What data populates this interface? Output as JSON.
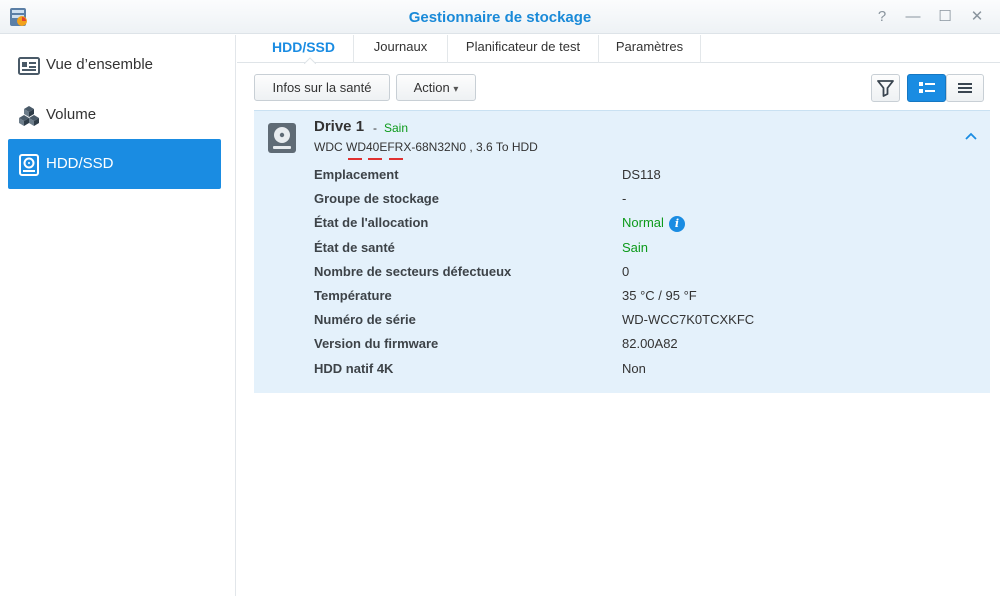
{
  "window": {
    "title": "Gestionnaire de stockage",
    "controls": [
      "?",
      "—",
      "☐",
      "✕"
    ]
  },
  "sidebar": {
    "items": [
      {
        "label": "Vue d’ensemble",
        "icon": "overview-icon"
      },
      {
        "label": "Volume",
        "icon": "volume-cubes-icon"
      },
      {
        "label": "HDD/SSD",
        "icon": "hdd-icon",
        "active": true
      }
    ]
  },
  "tabs": [
    {
      "label": "HDD/SSD",
      "active": true
    },
    {
      "label": "Journaux"
    },
    {
      "label": "Planificateur de test"
    },
    {
      "label": "Paramètres"
    }
  ],
  "toolbar": {
    "health_label": "Infos sur la santé",
    "action_label": "Action",
    "action_caret": "▾"
  },
  "drive": {
    "name": "Drive 1",
    "separator": "-",
    "status": "Sain",
    "model": "WDC WD40EFRX-68N32N0 , 3.6 To HDD",
    "details": [
      {
        "label": "Emplacement",
        "value": "DS118"
      },
      {
        "label": "Groupe de stockage",
        "value": "-"
      },
      {
        "label": "État de l'allocation",
        "value": "Normal",
        "green": true,
        "info": true
      },
      {
        "label": "État de santé",
        "value": "Sain",
        "green": true
      },
      {
        "label": "Nombre de secteurs défectueux",
        "value": "0"
      },
      {
        "label": "Température",
        "value": "35 °C / 95 °F"
      },
      {
        "label": "Numéro de série",
        "value": "WD-WCC7K0TCXKFC"
      },
      {
        "label": "Version du firmware",
        "value": "82.00A82"
      },
      {
        "label": "HDD natif 4K",
        "value": "Non"
      }
    ],
    "info_glyph": "i"
  },
  "colors": {
    "accent": "#1a8ce2",
    "title": "#1a8ad8",
    "healthy": "#0c9a1a",
    "panel": "#e4f1fb"
  }
}
